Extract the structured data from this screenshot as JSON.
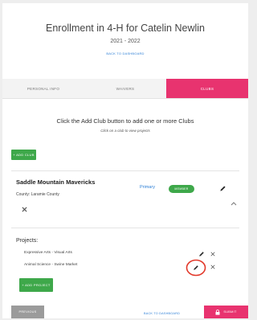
{
  "header": {
    "title": "Enrollment in 4-H for Catelin Newlin",
    "years": "2021 - 2022",
    "back_link": "BACK TO DASHBOARD"
  },
  "tabs": [
    {
      "label": "PERSONAL INFO",
      "active": false
    },
    {
      "label": "WAIVERS",
      "active": false
    },
    {
      "label": "CLUBS",
      "active": true
    }
  ],
  "clubs_section": {
    "instruction": "Click the Add Club button to add one or more Clubs",
    "subinstruction": "Click on a club to view projects",
    "add_club_label": "+ ADD CLUB"
  },
  "club": {
    "name": "Saddle Mountain Mavericks",
    "county": "County: Laramie County",
    "primary_label": "Primary",
    "status_badge": "MEMBER"
  },
  "projects": {
    "label": "Projects:",
    "items": [
      "Expressive Arts - Visual Arts",
      "Animal Science - Swine Market"
    ],
    "add_project_label": "+ ADD PROJECT"
  },
  "footer": {
    "previous_label": "PREVIOUS",
    "back_label": "BACK TO DASHBOARD",
    "submit_label": "SUBMIT"
  },
  "icons": {
    "edit": "pencil-icon",
    "remove": "close-icon",
    "collapse": "chevron-up-icon",
    "submit": "lock-icon"
  },
  "colors": {
    "accent_pink": "#e8336f",
    "success_green": "#3ea84a",
    "link_blue": "#2d7fd6",
    "annotation_red": "#e2382a"
  }
}
